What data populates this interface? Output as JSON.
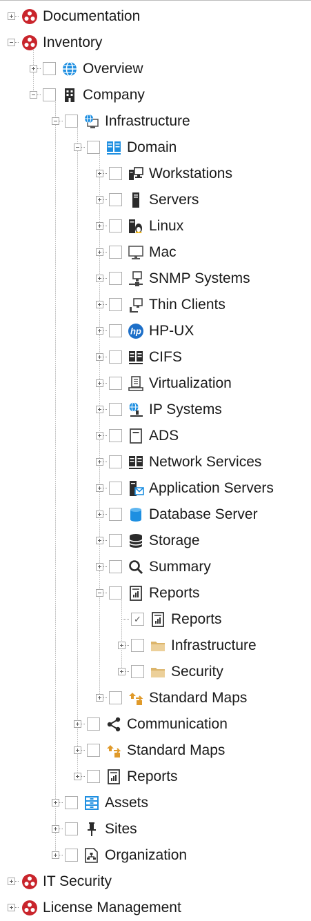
{
  "tree": {
    "items": [
      {
        "label": "Documentation",
        "depth": 0,
        "expander": "plus",
        "checkbox": false,
        "icon": "docusnap-logo-icon"
      },
      {
        "label": "Inventory",
        "depth": 0,
        "expander": "minus",
        "checkbox": false,
        "icon": "docusnap-logo-icon"
      },
      {
        "label": "Overview",
        "depth": 1,
        "expander": "plus",
        "checkbox": true,
        "checked": false,
        "icon": "globe-icon"
      },
      {
        "label": "Company",
        "depth": 1,
        "expander": "minus",
        "checkbox": true,
        "checked": false,
        "icon": "building-icon"
      },
      {
        "label": "Infrastructure",
        "depth": 2,
        "expander": "minus",
        "checkbox": true,
        "checked": false,
        "icon": "network-globe-icon"
      },
      {
        "label": "Domain",
        "depth": 3,
        "expander": "minus",
        "checkbox": true,
        "checked": false,
        "icon": "domain-servers-icon"
      },
      {
        "label": "Workstations",
        "depth": 4,
        "expander": "plus",
        "checkbox": true,
        "checked": false,
        "icon": "workstation-icon"
      },
      {
        "label": "Servers",
        "depth": 4,
        "expander": "plus",
        "checkbox": true,
        "checked": false,
        "icon": "server-icon"
      },
      {
        "label": "Linux",
        "depth": 4,
        "expander": "plus",
        "checkbox": true,
        "checked": false,
        "icon": "linux-server-icon"
      },
      {
        "label": "Mac",
        "depth": 4,
        "expander": "plus",
        "checkbox": true,
        "checked": false,
        "icon": "monitor-icon"
      },
      {
        "label": "SNMP Systems",
        "depth": 4,
        "expander": "plus",
        "checkbox": true,
        "checked": false,
        "icon": "snmp-icon"
      },
      {
        "label": "Thin Clients",
        "depth": 4,
        "expander": "plus",
        "checkbox": true,
        "checked": false,
        "icon": "thin-client-icon"
      },
      {
        "label": "HP-UX",
        "depth": 4,
        "expander": "plus",
        "checkbox": true,
        "checked": false,
        "icon": "hp-logo-icon"
      },
      {
        "label": "CIFS",
        "depth": 4,
        "expander": "plus",
        "checkbox": true,
        "checked": false,
        "icon": "cifs-servers-icon"
      },
      {
        "label": "Virtualization",
        "depth": 4,
        "expander": "plus",
        "checkbox": true,
        "checked": false,
        "icon": "virtualization-icon"
      },
      {
        "label": "IP Systems",
        "depth": 4,
        "expander": "plus",
        "checkbox": true,
        "checked": false,
        "icon": "ip-systems-icon"
      },
      {
        "label": "ADS",
        "depth": 4,
        "expander": "plus",
        "checkbox": true,
        "checked": false,
        "icon": "ads-icon"
      },
      {
        "label": "Network Services",
        "depth": 4,
        "expander": "plus",
        "checkbox": true,
        "checked": false,
        "icon": "network-services-icon"
      },
      {
        "label": "Application Servers",
        "depth": 4,
        "expander": "plus",
        "checkbox": true,
        "checked": false,
        "icon": "application-server-icon"
      },
      {
        "label": "Database Server",
        "depth": 4,
        "expander": "plus",
        "checkbox": true,
        "checked": false,
        "icon": "database-icon"
      },
      {
        "label": "Storage",
        "depth": 4,
        "expander": "plus",
        "checkbox": true,
        "checked": false,
        "icon": "storage-icon"
      },
      {
        "label": "Summary",
        "depth": 4,
        "expander": "plus",
        "checkbox": true,
        "checked": false,
        "icon": "magnifier-icon"
      },
      {
        "label": "Reports",
        "depth": 4,
        "expander": "minus",
        "checkbox": true,
        "checked": false,
        "icon": "report-icon"
      },
      {
        "label": "Reports",
        "depth": 5,
        "expander": "none",
        "checkbox": true,
        "checked": true,
        "icon": "report-icon"
      },
      {
        "label": "Infrastructure",
        "depth": 5,
        "expander": "plus",
        "checkbox": true,
        "checked": false,
        "icon": "folder-icon"
      },
      {
        "label": "Security",
        "depth": 5,
        "expander": "plus",
        "checkbox": true,
        "checked": false,
        "icon": "folder-icon"
      },
      {
        "label": "Standard Maps",
        "depth": 4,
        "expander": "plus",
        "checkbox": true,
        "checked": false,
        "icon": "maps-icon"
      },
      {
        "label": "Communication",
        "depth": 3,
        "expander": "plus",
        "checkbox": true,
        "checked": false,
        "icon": "share-icon"
      },
      {
        "label": "Standard Maps",
        "depth": 3,
        "expander": "plus",
        "checkbox": true,
        "checked": false,
        "icon": "maps-icon"
      },
      {
        "label": "Reports",
        "depth": 3,
        "expander": "plus",
        "checkbox": true,
        "checked": false,
        "icon": "report-icon"
      },
      {
        "label": "Assets",
        "depth": 2,
        "expander": "plus",
        "checkbox": true,
        "checked": false,
        "icon": "assets-icon"
      },
      {
        "label": "Sites",
        "depth": 2,
        "expander": "plus",
        "checkbox": true,
        "checked": false,
        "icon": "pin-icon"
      },
      {
        "label": "Organization",
        "depth": 2,
        "expander": "plus",
        "checkbox": true,
        "checked": false,
        "icon": "org-chart-icon"
      },
      {
        "label": "IT Security",
        "depth": 0,
        "expander": "plus",
        "checkbox": false,
        "icon": "docusnap-logo-icon"
      },
      {
        "label": "License Management",
        "depth": 0,
        "expander": "plus",
        "checkbox": false,
        "icon": "docusnap-logo-icon"
      }
    ]
  },
  "colors": {
    "logo_red": "#c9252c",
    "accent_blue": "#1e8fe1",
    "folder_tan": "#dcb56b",
    "map_orange": "#e09a2a",
    "dark_icon": "#2b2b2b"
  }
}
